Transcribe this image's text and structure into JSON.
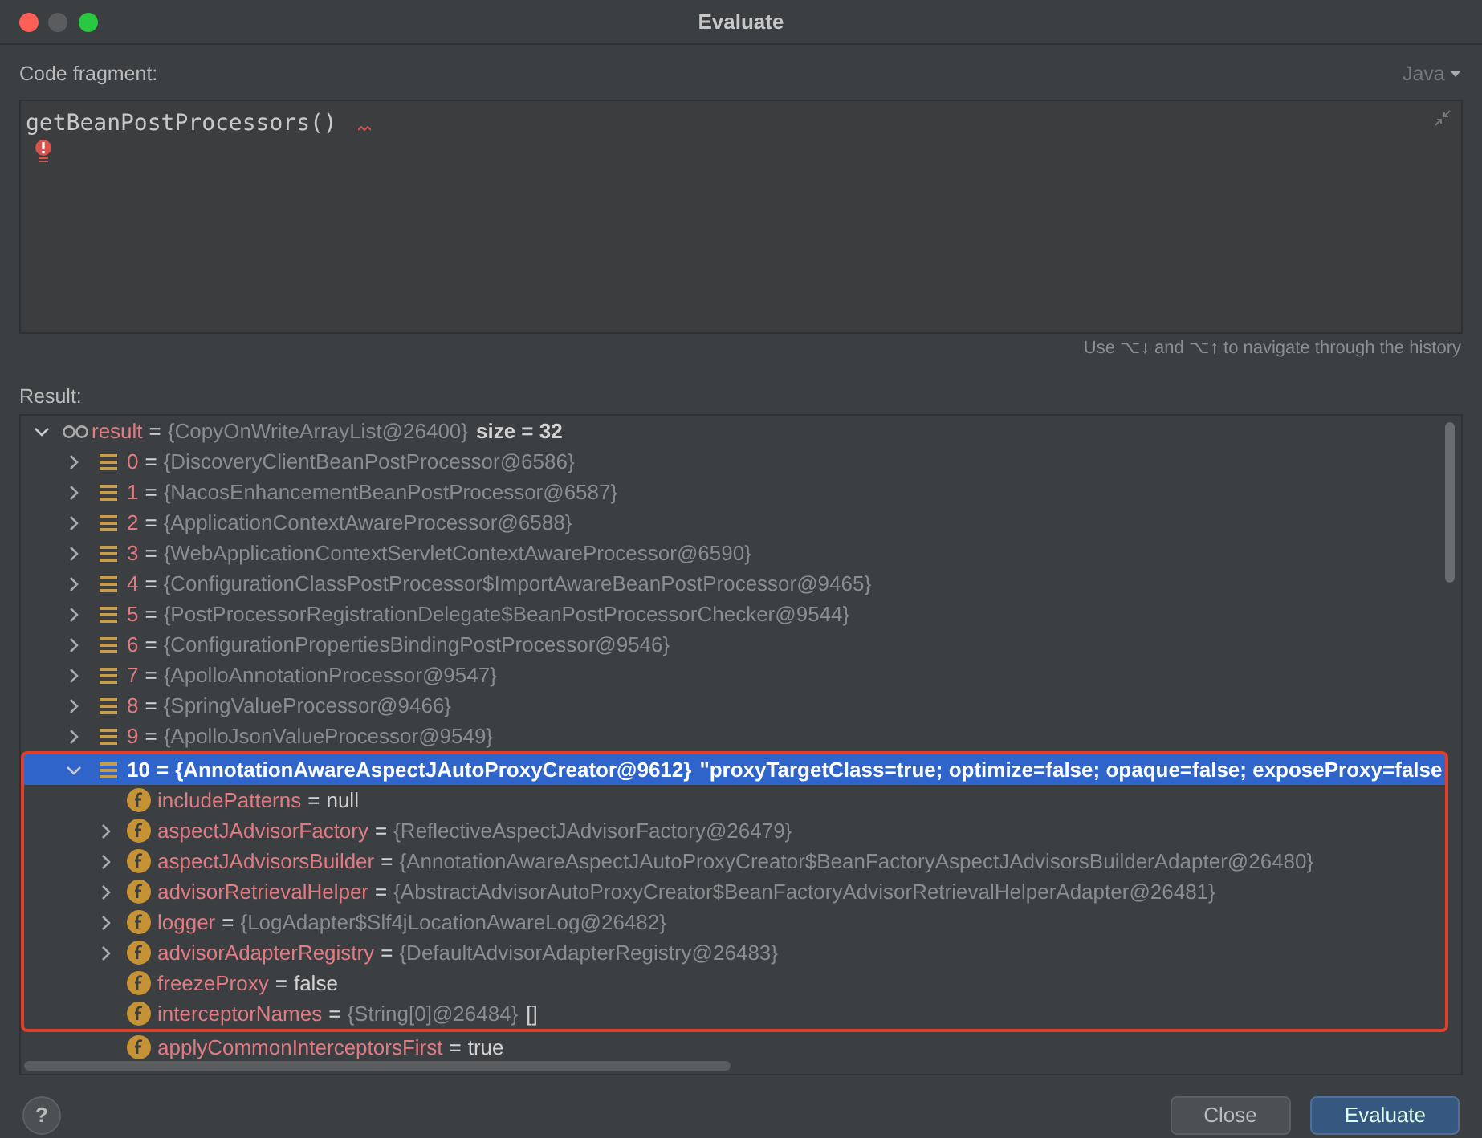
{
  "window": {
    "title": "Evaluate"
  },
  "code_fragment": {
    "label": "Code fragment:",
    "language": "Java",
    "code": "getBeanPostProcessors()",
    "has_error": true
  },
  "history_hint": "Use ⌥↓ and ⌥↑ to navigate through the history",
  "result": {
    "label": "Result:",
    "tree": [
      {
        "kind": "list",
        "name": "result",
        "eq": "=",
        "ref": "{CopyOnWriteArrayList@26400}",
        "value": "size = 32",
        "expandable": true,
        "expanded": true,
        "selected": false,
        "highlighted": false,
        "children": [
          {
            "kind": "element",
            "name": "0",
            "eq": "=",
            "ref": "{DiscoveryClientBeanPostProcessor@6586}",
            "expandable": true,
            "expanded": false,
            "selected": false,
            "highlighted": false
          },
          {
            "kind": "element",
            "name": "1",
            "eq": "=",
            "ref": "{NacosEnhancementBeanPostProcessor@6587}",
            "expandable": true,
            "expanded": false,
            "selected": false,
            "highlighted": false
          },
          {
            "kind": "element",
            "name": "2",
            "eq": "=",
            "ref": "{ApplicationContextAwareProcessor@6588}",
            "expandable": true,
            "expanded": false,
            "selected": false,
            "highlighted": false
          },
          {
            "kind": "element",
            "name": "3",
            "eq": "=",
            "ref": "{WebApplicationContextServletContextAwareProcessor@6590}",
            "expandable": true,
            "expanded": false,
            "selected": false,
            "highlighted": false
          },
          {
            "kind": "element",
            "name": "4",
            "eq": "=",
            "ref": "{ConfigurationClassPostProcessor$ImportAwareBeanPostProcessor@9465}",
            "expandable": true,
            "expanded": false,
            "selected": false,
            "highlighted": false
          },
          {
            "kind": "element",
            "name": "5",
            "eq": "=",
            "ref": "{PostProcessorRegistrationDelegate$BeanPostProcessorChecker@9544}",
            "expandable": true,
            "expanded": false,
            "selected": false,
            "highlighted": false
          },
          {
            "kind": "element",
            "name": "6",
            "eq": "=",
            "ref": "{ConfigurationPropertiesBindingPostProcessor@9546}",
            "expandable": true,
            "expanded": false,
            "selected": false,
            "highlighted": false
          },
          {
            "kind": "element",
            "name": "7",
            "eq": "=",
            "ref": "{ApolloAnnotationProcessor@9547}",
            "expandable": true,
            "expanded": false,
            "selected": false,
            "highlighted": false
          },
          {
            "kind": "element",
            "name": "8",
            "eq": "=",
            "ref": "{SpringValueProcessor@9466}",
            "expandable": true,
            "expanded": false,
            "selected": false,
            "highlighted": false
          },
          {
            "kind": "element",
            "name": "9",
            "eq": "=",
            "ref": "{ApolloJsonValueProcessor@9549}",
            "expandable": true,
            "expanded": false,
            "selected": false,
            "highlighted": false
          },
          {
            "kind": "element",
            "name": "10",
            "eq": "=",
            "ref": "{AnnotationAwareAspectJAutoProxyCreator@9612}",
            "value": "\"proxyTargetClass=true; optimize=false; opaque=false; exposeProxy=false",
            "expandable": true,
            "expanded": true,
            "selected": true,
            "highlighted": true,
            "children": [
              {
                "kind": "field",
                "name": "includePatterns",
                "eq": "=",
                "value": "null",
                "expandable": false,
                "expanded": false,
                "selected": false,
                "highlighted": true
              },
              {
                "kind": "field",
                "name": "aspectJAdvisorFactory",
                "eq": "=",
                "ref": "{ReflectiveAspectJAdvisorFactory@26479}",
                "expandable": true,
                "expanded": false,
                "selected": false,
                "highlighted": true
              },
              {
                "kind": "field",
                "name": "aspectJAdvisorsBuilder",
                "eq": "=",
                "ref": "{AnnotationAwareAspectJAutoProxyCreator$BeanFactoryAspectJAdvisorsBuilderAdapter@26480}",
                "expandable": true,
                "expanded": false,
                "selected": false,
                "highlighted": true
              },
              {
                "kind": "field",
                "name": "advisorRetrievalHelper",
                "eq": "=",
                "ref": "{AbstractAdvisorAutoProxyCreator$BeanFactoryAdvisorRetrievalHelperAdapter@26481}",
                "expandable": true,
                "expanded": false,
                "selected": false,
                "highlighted": true
              },
              {
                "kind": "field",
                "name": "logger",
                "eq": "=",
                "ref": "{LogAdapter$Slf4jLocationAwareLog@26482}",
                "expandable": true,
                "expanded": false,
                "selected": false,
                "highlighted": true
              },
              {
                "kind": "field",
                "name": "advisorAdapterRegistry",
                "eq": "=",
                "ref": "{DefaultAdvisorAdapterRegistry@26483}",
                "expandable": true,
                "expanded": false,
                "selected": false,
                "highlighted": true
              },
              {
                "kind": "field",
                "name": "freezeProxy",
                "eq": "=",
                "value": "false",
                "expandable": false,
                "expanded": false,
                "selected": false,
                "highlighted": true
              },
              {
                "kind": "field",
                "name": "interceptorNames",
                "eq": "=",
                "ref": "{String[0]@26484}",
                "value": "[]",
                "expandable": false,
                "expanded": false,
                "selected": false,
                "highlighted": true
              },
              {
                "kind": "field",
                "name": "applyCommonInterceptorsFirst",
                "eq": "=",
                "value": "true",
                "expandable": false,
                "expanded": false,
                "selected": false,
                "highlighted": false
              }
            ]
          }
        ]
      }
    ]
  },
  "help_button": "?",
  "buttons": [
    {
      "label": "Close",
      "primary": false
    },
    {
      "label": "Evaluate",
      "primary": true
    }
  ]
}
